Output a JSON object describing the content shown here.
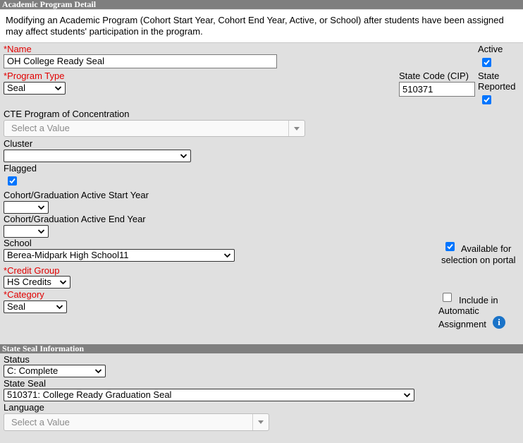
{
  "detail": {
    "header": "Academic Program Detail",
    "notice": "Modifying an Academic Program (Cohort Start Year, Cohort End Year, Active, or School) after students have been assigned may affect students' participation in the program."
  },
  "form": {
    "name": {
      "required_mark": "*",
      "label": "Name",
      "value": "OH College Ready Seal"
    },
    "active": {
      "label": "Active",
      "checked": true
    },
    "program_type": {
      "required_mark": "*",
      "label": "Program Type",
      "value": "Seal"
    },
    "state_code": {
      "label": "State Code (CIP)",
      "value": "510371"
    },
    "state_reported": {
      "label_line1": "State",
      "label_line2": "Reported",
      "checked": true
    },
    "cte_program": {
      "label": "CTE Program of Concentration",
      "placeholder": "Select a Value"
    },
    "cluster": {
      "label": "Cluster",
      "value": ""
    },
    "flagged": {
      "label": "Flagged",
      "checked": true
    },
    "cohort_start": {
      "label": "Cohort/Graduation Active Start Year",
      "value": ""
    },
    "cohort_end": {
      "label": "Cohort/Graduation Active End Year",
      "value": ""
    },
    "school": {
      "label": "School",
      "value": "Berea-Midpark High School11"
    },
    "available_portal": {
      "label_line1": "Available for",
      "label_line2": "selection on portal",
      "checked": true
    },
    "credit_group": {
      "required_mark": "*",
      "label": "Credit Group",
      "value": "HS Credits"
    },
    "category": {
      "required_mark": "*",
      "label": "Category",
      "value": "Seal"
    },
    "auto_assign": {
      "label_line1": "Include in",
      "label_line2": "Automatic",
      "label_line3": "Assignment",
      "checked": false,
      "info_glyph": "i"
    }
  },
  "seal": {
    "header": "State Seal Information",
    "status": {
      "label": "Status",
      "value": "C: Complete"
    },
    "state_seal": {
      "label": "State Seal",
      "value": "510371: College Ready Graduation Seal"
    },
    "language": {
      "label": "Language",
      "placeholder": "Select a Value"
    }
  },
  "colors": {
    "required": "#e10000",
    "header_bg": "#7f7f7f",
    "checkbox": "#0075ff",
    "info": "#1a73c8"
  }
}
